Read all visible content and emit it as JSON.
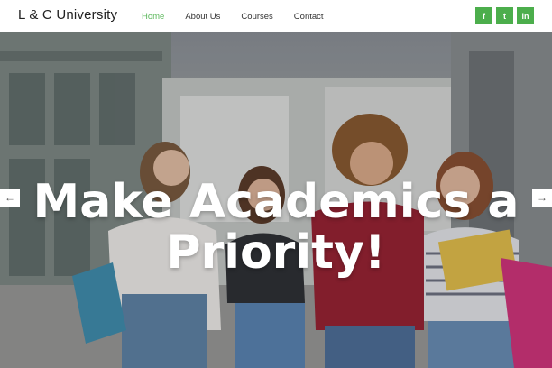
{
  "brand": "L & C University",
  "nav": {
    "home": "Home",
    "about": "About Us",
    "courses": "Courses",
    "contact": "Contact"
  },
  "social": {
    "facebook": "f",
    "twitter": "t",
    "linkedin": "in"
  },
  "hero": {
    "line1": "Make Academics a",
    "line2": "Priority!",
    "prev_icon": "←",
    "next_icon": "→"
  },
  "colors": {
    "accent": "#5cb85c",
    "social_bg": "#4cae4c"
  },
  "icons": {
    "prev": "arrow-left-icon",
    "next": "arrow-right-icon"
  }
}
